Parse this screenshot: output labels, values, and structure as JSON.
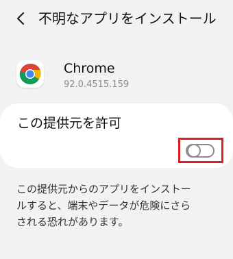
{
  "header": {
    "title": "不明なアプリをインストール"
  },
  "app": {
    "name": "Chrome",
    "version": "92.0.4515.159"
  },
  "setting": {
    "label": "この提供元を許可",
    "toggle_state": "off"
  },
  "description": {
    "lines": [
      "この提供元からのアプリをインストー",
      "ルすると、端末やデータが危険にさら",
      "される恐れがあります。"
    ]
  },
  "colors": {
    "background": "#f2f2f2",
    "card": "#ffffff",
    "highlight": "#d61f26",
    "toggle_off": "#8c8c8c"
  }
}
